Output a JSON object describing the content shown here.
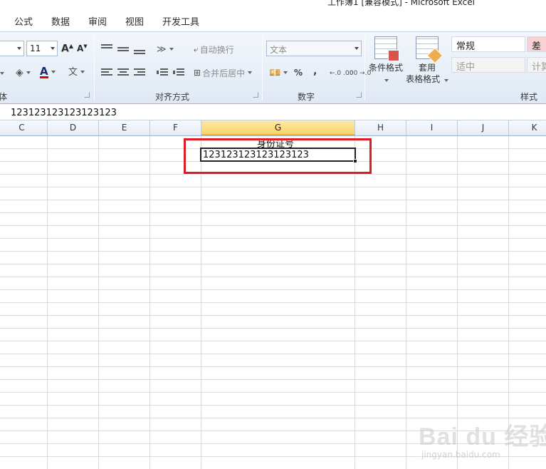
{
  "window": {
    "title": "工作簿1 [兼容模式] - Microsoft Excel"
  },
  "tabs": [
    {
      "label": "公式"
    },
    {
      "label": "数据"
    },
    {
      "label": "审阅"
    },
    {
      "label": "视图"
    },
    {
      "label": "开发工具"
    }
  ],
  "ribbon": {
    "font": {
      "size_value": "11",
      "grow_icon": "font-grow-icon",
      "shrink_icon": "font-shrink-icon",
      "font_color": "#e00000",
      "group_label_partial": "体"
    },
    "alignment": {
      "wrap_text_label": "自动换行",
      "merge_center_label": "合并后居中",
      "group_label": "对齐方式"
    },
    "number": {
      "format_value": "文本",
      "percent_label": "%",
      "comma_label": ",",
      "inc_decimal_label": "←.0 .00",
      "dec_decimal_label": ".00 →.0",
      "group_label": "数字"
    },
    "styles": {
      "conditional_format_label": "条件格式",
      "table_format_label_1": "套用",
      "table_format_label_2": "表格格式",
      "normal_label": "常规",
      "bad_label": "差",
      "neutral_label": "适中",
      "calc_label": "计算",
      "group_label": "样式",
      "bad_color": "#f8d2d2",
      "neutral_color": "#ffefb3"
    }
  },
  "formula_bar": {
    "value": "123123123123123123"
  },
  "sheet": {
    "columns": [
      "C",
      "D",
      "E",
      "F",
      "G",
      "H",
      "I",
      "J",
      "K"
    ],
    "selected_column": "G",
    "header_cell": "身份证号",
    "active_cell_value": "123123123123123123",
    "highlight_color": "#e01b24"
  },
  "watermark": {
    "logo": "Bai du 经验",
    "url": "jingyan.baidu.com"
  }
}
